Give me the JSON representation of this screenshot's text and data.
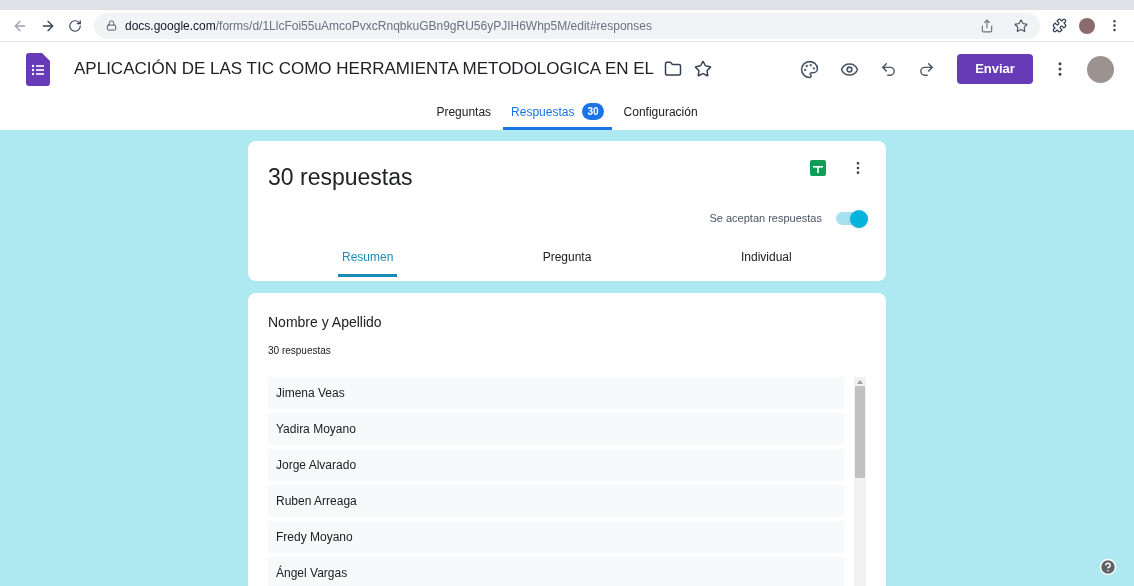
{
  "browser": {
    "url_host": "docs.google.com",
    "url_path": "/forms/d/1LlcFoi55uAmcoPvxcRnqbkuGBn9gRU56yPJIH6Whp5M/edit#responses"
  },
  "header": {
    "title": "APLICACIÓN DE LAS TIC COMO HERRAMIENTA METODOLOGICA EN EL",
    "send_button": "Enviar"
  },
  "tabs": [
    {
      "label": "Preguntas",
      "selected": false
    },
    {
      "label": "Respuestas",
      "selected": true,
      "badge": "30"
    },
    {
      "label": "Configuración",
      "selected": false
    }
  ],
  "summary": {
    "title": "30 respuestas",
    "accepting_label": "Se aceptan respuestas",
    "accepting": true,
    "tabs": [
      {
        "label": "Resumen",
        "selected": true
      },
      {
        "label": "Pregunta",
        "selected": false
      },
      {
        "label": "Individual",
        "selected": false
      }
    ]
  },
  "question": {
    "title": "Nombre y Apellido",
    "count": "30 respuestas",
    "answers": [
      "Jimena Veas",
      "Yadira Moyano",
      "Jorge Alvarado",
      "Ruben Arreaga",
      "Fredy Moyano",
      "Ángel Vargas"
    ]
  }
}
